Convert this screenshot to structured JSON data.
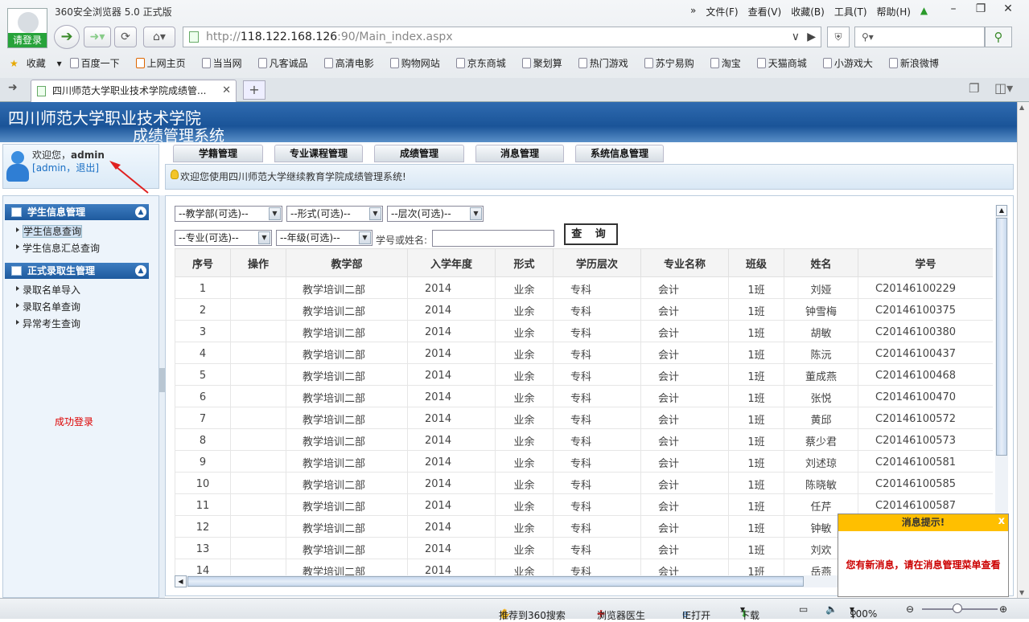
{
  "browser": {
    "title": "360安全浏览器 5.0 正式版",
    "login_label": "请登录",
    "menu": [
      "文件(F)",
      "查看(V)",
      "收藏(B)",
      "工具(T)",
      "帮助(H)"
    ],
    "menu_more": "»",
    "address_prefix": "http://",
    "address_host": "118.122.168.126",
    "address_rest": ":90/Main_index.aspx",
    "search_placeholder": "",
    "bookmarks": [
      "收藏",
      "百度一下",
      "上网主页",
      "当当网",
      "凡客诚品",
      "高清电影",
      "购物网站",
      "京东商城",
      "聚划算",
      "热门游戏",
      "苏宁易购",
      "淘宝",
      "天猫商城",
      "小游戏大",
      "新浪微博"
    ],
    "tab_title": "四川师范大学职业技术学院成绩管..."
  },
  "header": {
    "title_line1": "四川师范大学职业技术学院",
    "title_line2": "成绩管理系统"
  },
  "user": {
    "welcome_prefix": "欢迎您，",
    "username": "admin",
    "links_open": "[",
    "account_link": "admin",
    "sep": "，",
    "logout_link": "退出",
    "links_close": "]"
  },
  "top_nav": [
    "学籍管理",
    "专业课程管理",
    "成绩管理",
    "消息管理",
    "系统信息管理"
  ],
  "notice": "欢迎您使用四川师范大学继续教育学院成绩管理系统!",
  "sidebar": {
    "section1": {
      "title": "学生信息管理",
      "items": [
        "学生信息查询",
        "学生信息汇总查询"
      ]
    },
    "section2": {
      "title": "正式录取生管理",
      "items": [
        "录取名单导入",
        "录取名单查询",
        "异常考生查询"
      ]
    },
    "status_message": "成功登录"
  },
  "filters": {
    "department": "--教学部(可选)--",
    "form": "--形式(可选)--",
    "level": "--层次(可选)--",
    "major": "--专业(可选)--",
    "grade": "--年级(可选)--",
    "keyword_label": "学号或姓名:",
    "keyword_value": "",
    "query_button": "查 询"
  },
  "table": {
    "headers": [
      "序号",
      "操作",
      "教学部",
      "入学年度",
      "形式",
      "学历层次",
      "专业名称",
      "班级",
      "姓名",
      "学号"
    ],
    "rows": [
      [
        "1",
        "",
        "教学培训二部",
        "2014",
        "业余",
        "专科",
        "会计",
        "1班",
        "刘娅",
        "C20146100229"
      ],
      [
        "2",
        "",
        "教学培训二部",
        "2014",
        "业余",
        "专科",
        "会计",
        "1班",
        "钟雪梅",
        "C20146100375"
      ],
      [
        "3",
        "",
        "教学培训二部",
        "2014",
        "业余",
        "专科",
        "会计",
        "1班",
        "胡敏",
        "C20146100380"
      ],
      [
        "4",
        "",
        "教学培训二部",
        "2014",
        "业余",
        "专科",
        "会计",
        "1班",
        "陈沅",
        "C20146100437"
      ],
      [
        "5",
        "",
        "教学培训二部",
        "2014",
        "业余",
        "专科",
        "会计",
        "1班",
        "董成燕",
        "C20146100468"
      ],
      [
        "6",
        "",
        "教学培训二部",
        "2014",
        "业余",
        "专科",
        "会计",
        "1班",
        "张悦",
        "C20146100470"
      ],
      [
        "7",
        "",
        "教学培训二部",
        "2014",
        "业余",
        "专科",
        "会计",
        "1班",
        "黄邱",
        "C20146100572"
      ],
      [
        "8",
        "",
        "教学培训二部",
        "2014",
        "业余",
        "专科",
        "会计",
        "1班",
        "蔡少君",
        "C20146100573"
      ],
      [
        "9",
        "",
        "教学培训二部",
        "2014",
        "业余",
        "专科",
        "会计",
        "1班",
        "刘述琼",
        "C20146100581"
      ],
      [
        "10",
        "",
        "教学培训二部",
        "2014",
        "业余",
        "专科",
        "会计",
        "1班",
        "陈晓敏",
        "C20146100585"
      ],
      [
        "11",
        "",
        "教学培训二部",
        "2014",
        "业余",
        "专科",
        "会计",
        "1班",
        "任芹",
        "C20146100587"
      ],
      [
        "12",
        "",
        "教学培训二部",
        "2014",
        "业余",
        "专科",
        "会计",
        "1班",
        "钟敏",
        ""
      ],
      [
        "13",
        "",
        "教学培训二部",
        "2014",
        "业余",
        "专科",
        "会计",
        "1班",
        "刘欢",
        ""
      ],
      [
        "14",
        "",
        "教学培训二部",
        "2014",
        "业余",
        "专科",
        "会计",
        "1班",
        "岳燕",
        ""
      ]
    ]
  },
  "popup": {
    "title": "消息提示!",
    "close": "x",
    "message": "您有新消息，请在消息管理菜单查看"
  },
  "statusbar": {
    "recommend": "推荐到360搜索",
    "doctor": "浏览器医生",
    "ie_open": "IE打开",
    "download": "下载",
    "zoom": "100%"
  },
  "colors": {
    "header_blue": "#1a5498",
    "login_green": "#27a33a",
    "popup_yellow": "#ffbf00",
    "alert_red": "#cc0000"
  }
}
